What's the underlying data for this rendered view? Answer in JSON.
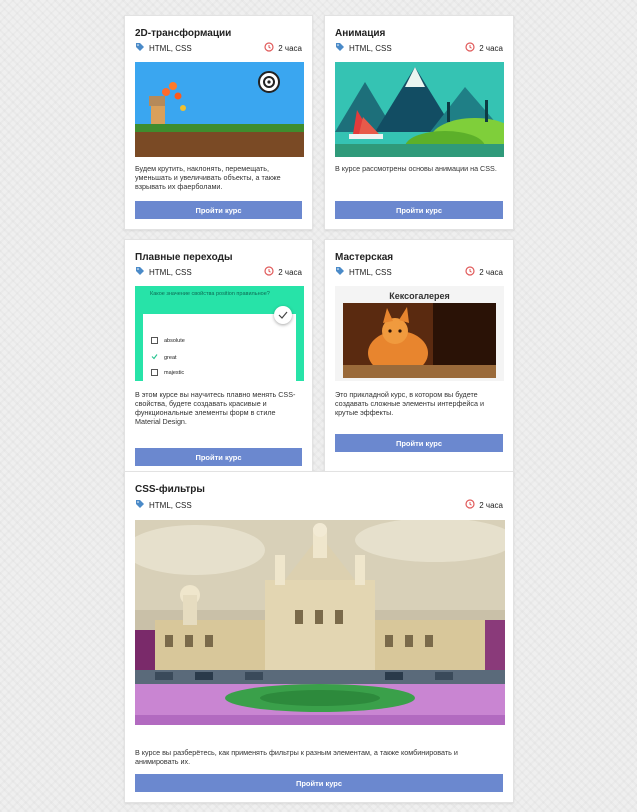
{
  "courses": [
    {
      "title": "2D-трансформации",
      "tags": "HTML, CSS",
      "duration": "2 часа",
      "description": "Будем крутить, наклонять, перемещать, уменьшать и увеличивать объекты, а также взрывать их фаерболами.",
      "button": "Пройти курс"
    },
    {
      "title": "Анимация",
      "tags": "HTML, CSS",
      "duration": "2 часа",
      "description": "В курсе рассмотрены основы анимации на CSS.",
      "button": "Пройти курс"
    },
    {
      "title": "Плавные переходы",
      "tags": "HTML, CSS",
      "duration": "2 часа",
      "description": "В этом курсе вы научитесь плавно менять CSS-свойства, будете создавать красивые и функциональные элементы форм в стиле Material Design.",
      "button": "Пройти курс",
      "preview": {
        "question": "Какое значение свойства position правильное?",
        "options": [
          "absolute",
          "great",
          "majestic"
        ]
      }
    },
    {
      "title": "Мастерская",
      "tags": "HTML, CSS",
      "duration": "2 часа",
      "description": "Это прикладной курс, в котором вы будете создавать сложные элементы интерфейса и крутые эффекты.",
      "button": "Пройти курс",
      "preview": {
        "heading": "Кексогалерея"
      }
    },
    {
      "title": "CSS-фильтры",
      "tags": "HTML, CSS",
      "duration": "2 часа",
      "description": "В курсе вы разберётесь, как применять фильтры к разным элементам, а также комбинировать и анимировать их.",
      "button": "Пройти курс"
    }
  ],
  "colors": {
    "button": "#6b88cf",
    "tag_icon": "#4a8ac8",
    "clock_icon": "#e05a5a",
    "accent_green": "#27e3a8"
  }
}
